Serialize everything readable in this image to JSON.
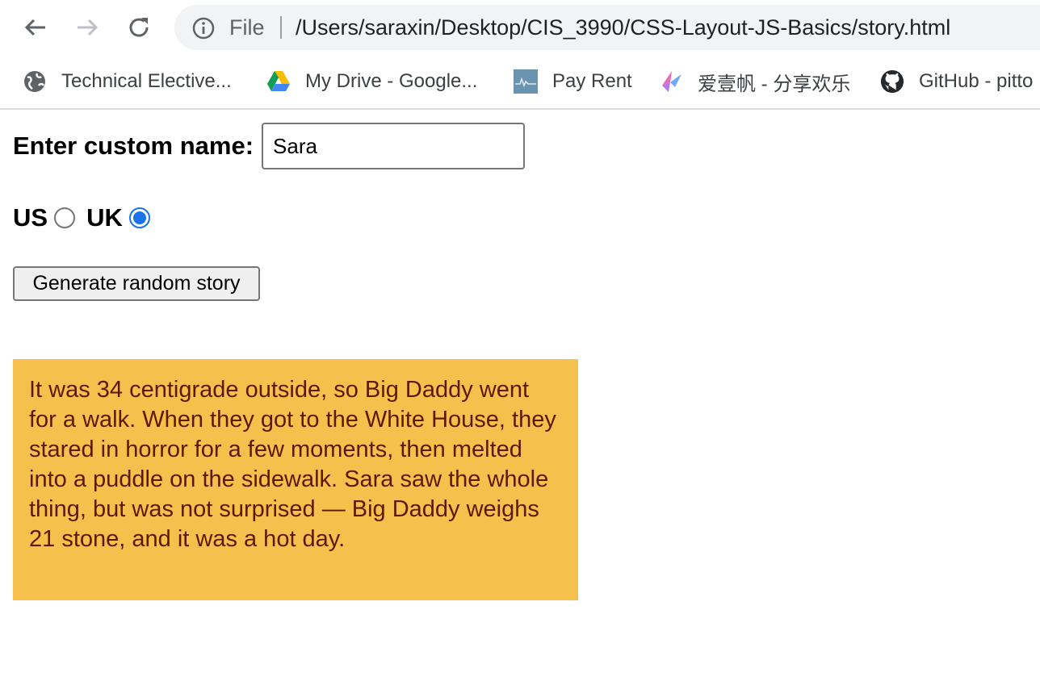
{
  "browser": {
    "omnibox": {
      "scheme_label": "File",
      "url": "/Users/saraxin/Desktop/CIS_3990/CSS-Layout-JS-Basics/story.html"
    },
    "bookmarks": [
      {
        "label": "Technical Elective...",
        "icon": "globe-icon"
      },
      {
        "label": "My Drive - Google...",
        "icon": "google-drive-icon"
      },
      {
        "label": "Pay Rent",
        "icon": "pay-rent-icon"
      },
      {
        "label": "爱壹帆 - 分享欢乐",
        "icon": "aiyifan-icon"
      },
      {
        "label": "GitHub - pitto",
        "icon": "github-icon"
      }
    ]
  },
  "form": {
    "name_label": "Enter custom name:",
    "name_value": "Sara",
    "radio_us_label": "US",
    "radio_uk_label": "UK",
    "selected_locale": "UK",
    "generate_label": "Generate random story"
  },
  "story": {
    "text": "It was 34 centigrade outside, so Big Daddy went for a walk. When they got to the White House, they stared in horror for a few moments, then melted into a puddle on the sidewalk. Sara saw the whole thing, but was not surprised — Big Daddy weighs 21 stone, and it was a hot day."
  },
  "colors": {
    "story_background": "#f5c14c",
    "story_text": "#5c1a03",
    "radio_accent": "#1a73e8"
  }
}
